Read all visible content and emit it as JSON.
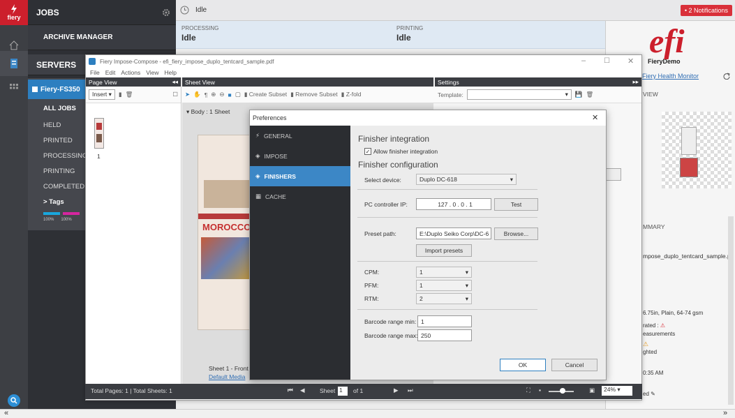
{
  "app": {
    "jobs_title": "JOBS",
    "archive_label": "ARCHIVE MANAGER",
    "servers_title": "SERVERS",
    "server_name": "Fiery-FS350",
    "logo_text": "fiery"
  },
  "job_filters": [
    "ALL JOBS",
    "HELD",
    "PRINTED",
    "PROCESSING",
    "PRINTING",
    "COMPLETED"
  ],
  "tags_label": "> Tags",
  "ink_levels": [
    "100%",
    "100%"
  ],
  "status": {
    "top": "Idle",
    "processing_label": "PROCESSING",
    "processing_value": "Idle",
    "printing_label": "PRINTING",
    "printing_value": "Idle",
    "notifications": "• 2 Notifications"
  },
  "right_panel": {
    "server": "FieryDemo",
    "health": "Fiery Health Monitor",
    "view_label": "VIEW",
    "summary_label": "MMARY",
    "filename": "mpose_duplo_tentcard_sample.p",
    "media": "6.75in, Plain, 64-74 gsm",
    "rated": "rated :",
    "measurements": "easurements",
    "ghted": "ghted",
    "time": "0:35 AM",
    "ed": "ed"
  },
  "window": {
    "title": "Fiery Impose-Compose - efi_fiery_impose_duplo_tentcard_sample.pdf",
    "menu": [
      "File",
      "Edit",
      "Actions",
      "View",
      "Help"
    ]
  },
  "page_view": {
    "title": "Page View",
    "insert_label": "Insert",
    "page_number": "1"
  },
  "sheet_view": {
    "title": "Sheet View",
    "create_subset": "Create Subset",
    "remove_subset": "Remove Subset",
    "zfold": "Z-fold",
    "body_label": "Body : 1 Sheet",
    "sheet_caption": "Sheet 1 - Front",
    "media_link": "Default Media",
    "poster_text": "MOROCCO"
  },
  "settings": {
    "title": "Settings",
    "template_label": "Template:"
  },
  "dialog": {
    "title": "Preferences",
    "sidebar": [
      "GENERAL",
      "IMPOSE",
      "FINISHERS",
      "CACHE"
    ],
    "finisher_integration": "Finisher integration",
    "allow_label": "Allow finisher integration",
    "finisher_config": "Finisher configuration",
    "select_device_label": "Select device:",
    "select_device_value": "Duplo DC-618",
    "pc_ip_label": "PC controller IP:",
    "pc_ip_value": "127 . 0 . 0 . 1",
    "test_button": "Test",
    "preset_label": "Preset path:",
    "preset_value": "E:\\Duplo Seiko Corp\\DC-6",
    "browse_button": "Browse...",
    "import_button": "Import presets",
    "cpm_label": "CPM:",
    "cpm_value": "1",
    "pfm_label": "PFM:",
    "pfm_value": "1",
    "rtm_label": "RTM:",
    "rtm_value": "2",
    "barcode_min_label": "Barcode range min:",
    "barcode_min_value": "1",
    "barcode_max_label": "Barcode range max:",
    "barcode_max_value": "250",
    "ok_button": "OK",
    "cancel_button": "Cancel"
  },
  "bottom": {
    "totals": "Total Pages: 1 | Total Sheets: 1",
    "sheet_label": "Sheet",
    "sheet_value": "1",
    "of_label": "of 1",
    "zoom": "24%"
  },
  "colors": {
    "accent": "#3c87c6",
    "brand_red": "#cc1f2c",
    "dark": "#2e3035"
  }
}
